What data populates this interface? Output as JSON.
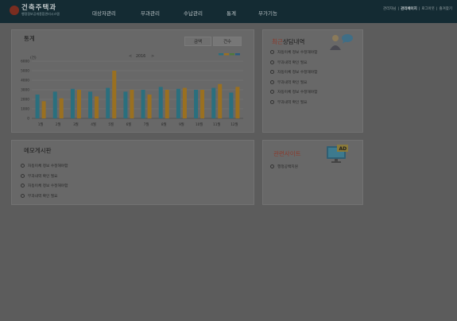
{
  "header": {
    "logo_title": "건축주택과",
    "logo_subtitle": "행정정보공개종합관리시스템",
    "nav": [
      "대상자관리",
      "부과관리",
      "수납관리",
      "통계",
      "부가기능"
    ],
    "util": {
      "user": "관리자님",
      "admin": "관리페이지",
      "logout": "로그아웃",
      "sitemap": "즐겨찾기"
    }
  },
  "stats": {
    "title": "통계",
    "toggle": [
      "금액",
      "건수"
    ],
    "unit": "(건)",
    "year": "2016",
    "prev": "<",
    "next": ">"
  },
  "chart_data": {
    "type": "bar",
    "categories": [
      "1월",
      "2월",
      "3월",
      "4월",
      "5월",
      "6월",
      "7월",
      "8월",
      "9월",
      "10월",
      "11월",
      "12월"
    ],
    "series": [
      {
        "values": [
          2500,
          2800,
          3100,
          2800,
          3200,
          2800,
          3000,
          3300,
          3100,
          3000,
          3200,
          2700
        ]
      },
      {
        "values": [
          1800,
          2100,
          3000,
          2300,
          5000,
          3000,
          2500,
          3000,
          3200,
          3000,
          3600,
          3300
        ]
      }
    ],
    "ylim": [
      0,
      6000
    ],
    "yticks": [
      0,
      1000,
      2000,
      3000,
      4000,
      5000,
      6000
    ],
    "grid": true,
    "colors": [
      "#2a6f7e",
      "#9a7020"
    ],
    "legend_swatches": [
      "#2a6f7e",
      "#9a7020",
      "#4d7a3a",
      "#2a5a80"
    ]
  },
  "consult": {
    "title_a": "최근",
    "title_b": "상담내역",
    "items": [
      "자동이체 정보 수정해야함",
      "부과내역 확인 필요",
      "자동이체 정보 수정해야함",
      "부과내역 확인 필요",
      "자동이체 정보 수정해야함",
      "부과내역 확인 필요"
    ]
  },
  "notes": {
    "title": "메모게시판",
    "items": [
      "자동이체 정보 수정해야함",
      "부과내역 확인 필요",
      "자동이체 정보 수정해야함",
      "부과내역 확인 필요"
    ]
  },
  "links": {
    "title": "관련사이트",
    "items": [
      "행정공백지원"
    ],
    "badge": "AD"
  }
}
